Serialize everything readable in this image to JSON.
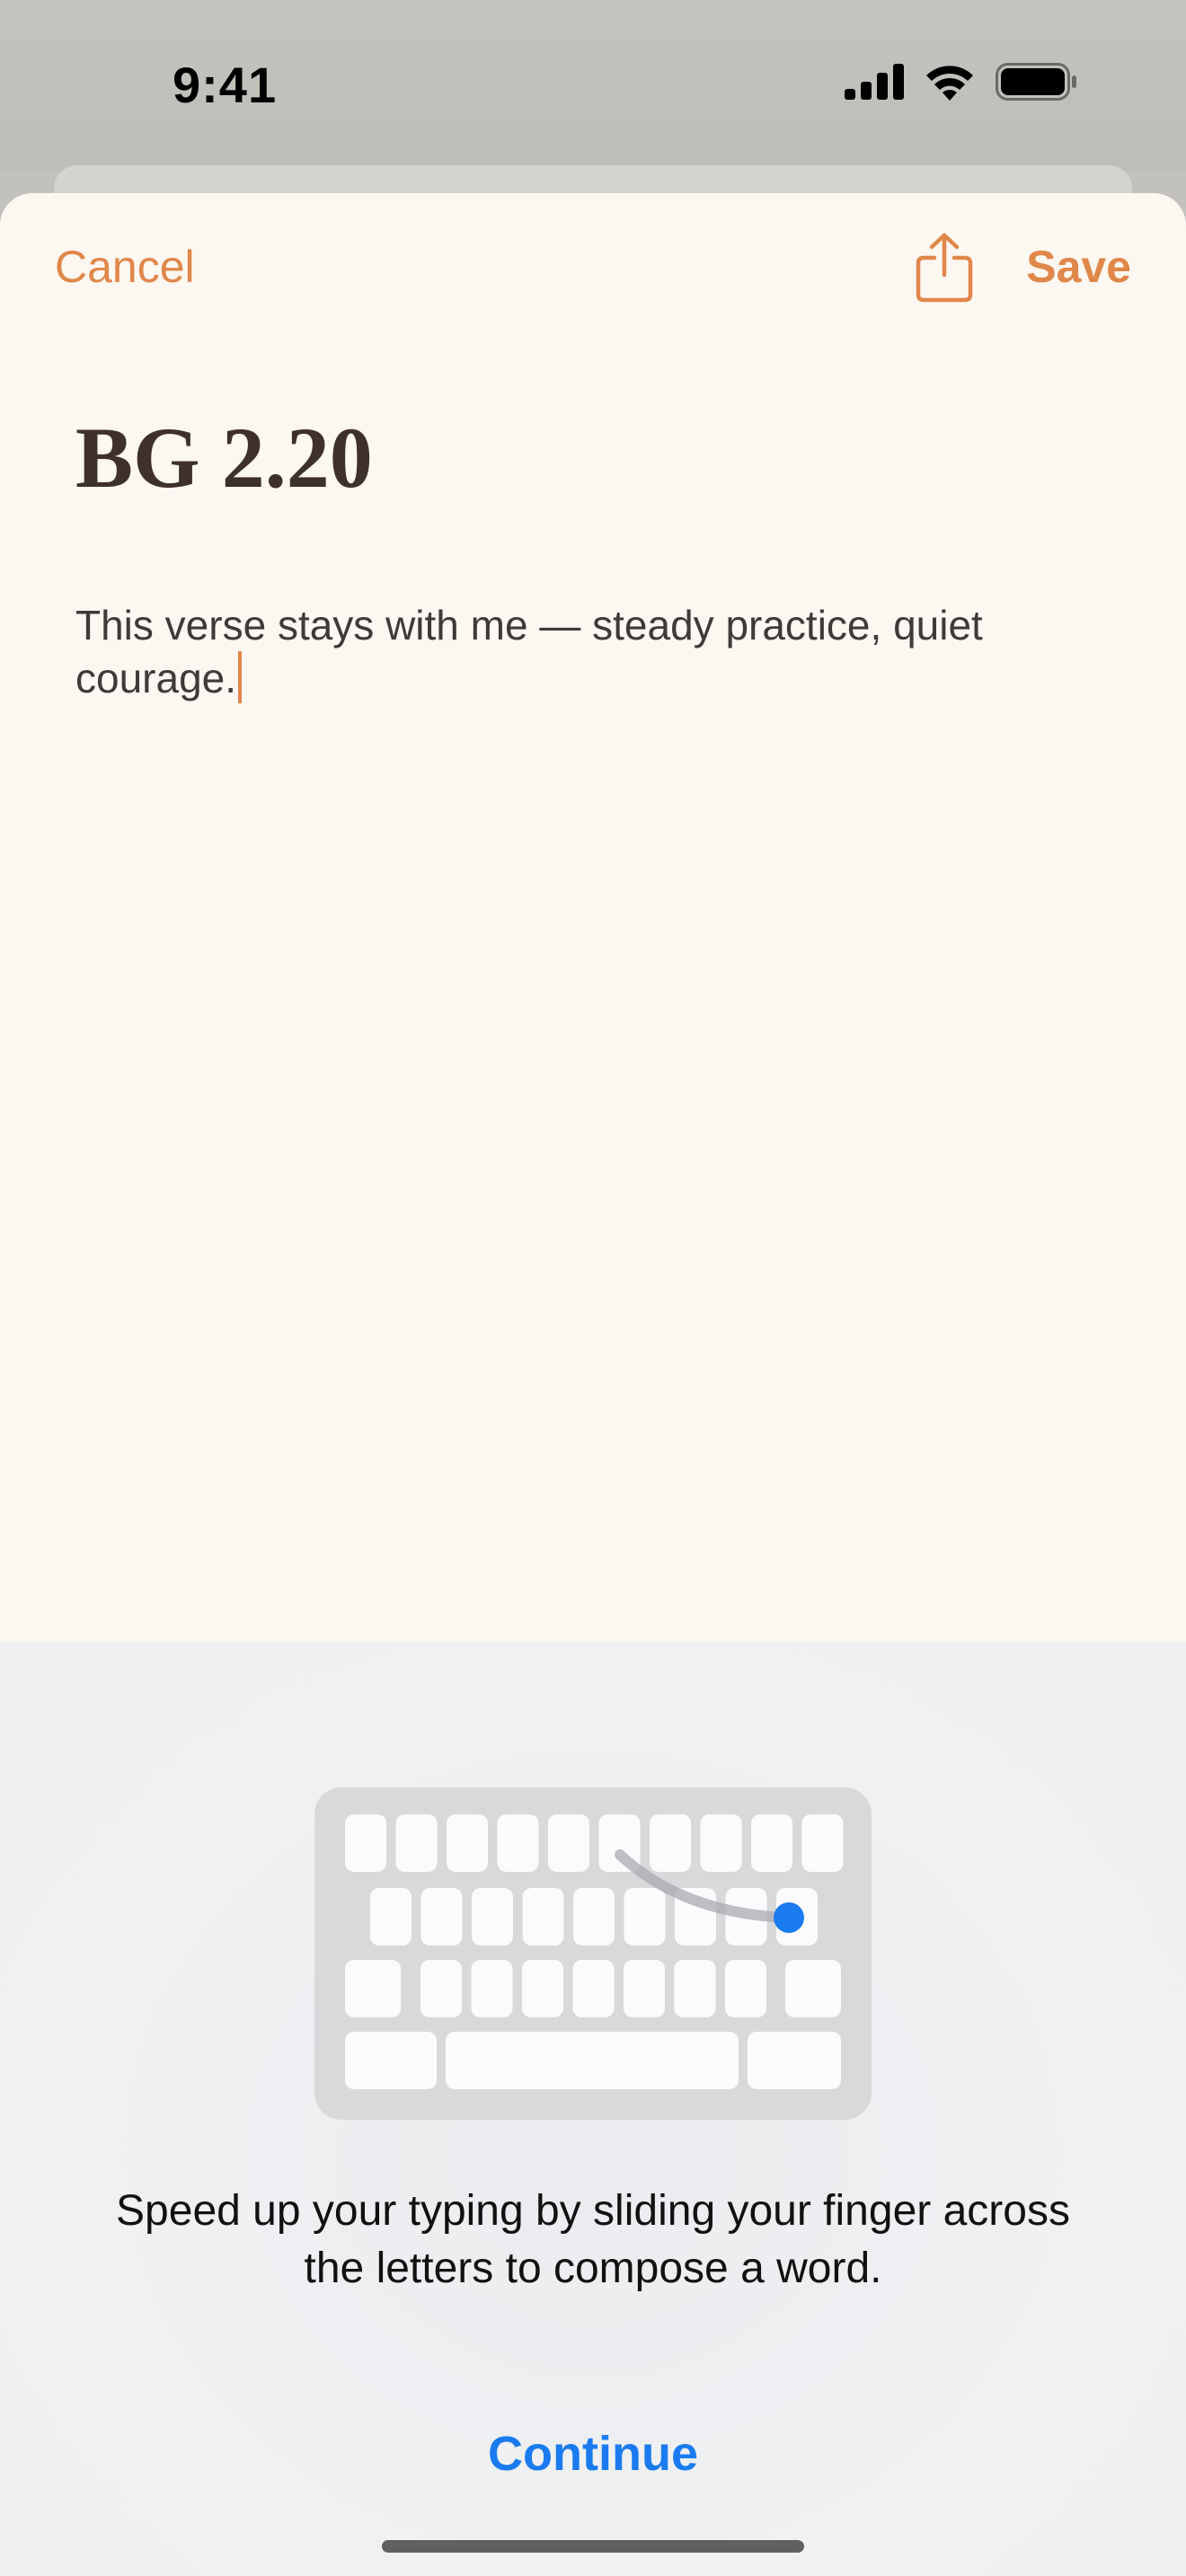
{
  "status_bar": {
    "time": "9:41",
    "icons": [
      "cellular-signal-icon",
      "wifi-icon",
      "battery-icon"
    ]
  },
  "nav": {
    "cancel_label": "Cancel",
    "share_icon": "share-icon",
    "save_label": "Save"
  },
  "note": {
    "title": "BG 2.20",
    "body": "This verse stays with me — steady practice, quiet courage."
  },
  "keyboard_tip": {
    "message": "Speed up your typing by sliding your finger across the letters to compose a word.",
    "continue_label": "Continue"
  },
  "colors": {
    "accent": "#e0874a",
    "link_blue": "#1a7bf0",
    "sheet_background": "#fcf7f1",
    "title_text": "#3e302b",
    "swipe_dot": "#1a7bf0"
  }
}
